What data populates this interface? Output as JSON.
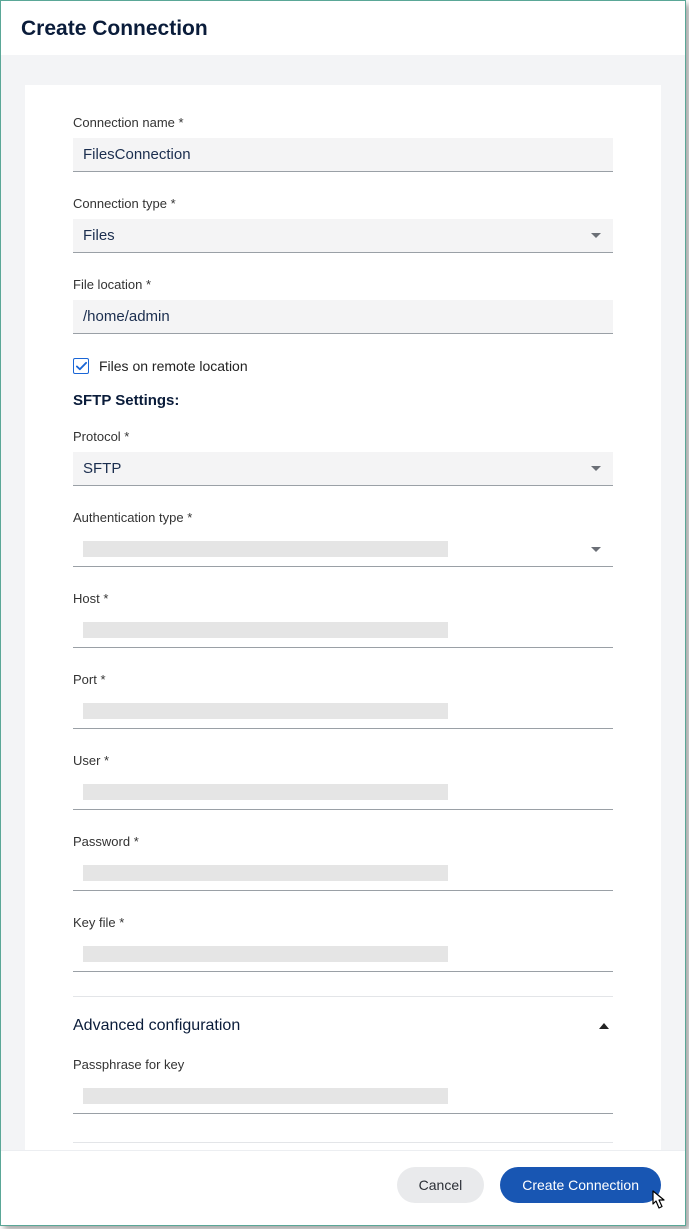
{
  "dialog": {
    "title": "Create Connection"
  },
  "form": {
    "connectionName": {
      "label": "Connection name *",
      "value": "FilesConnection"
    },
    "connectionType": {
      "label": "Connection type *",
      "value": "Files"
    },
    "fileLocation": {
      "label": "File location *",
      "value": "/home/admin"
    },
    "remoteCheckbox": {
      "label": "Files on remote location",
      "checked": true
    },
    "sftpHeading": "SFTP Settings:",
    "protocol": {
      "label": "Protocol *",
      "value": "SFTP"
    },
    "authType": {
      "label": "Authentication type *",
      "value": ""
    },
    "host": {
      "label": "Host *",
      "value": ""
    },
    "port": {
      "label": "Port *",
      "value": ""
    },
    "user": {
      "label": "User *",
      "value": ""
    },
    "password": {
      "label": "Password *",
      "value": ""
    },
    "keyFile": {
      "label": "Key file *",
      "value": ""
    },
    "advanced": {
      "title": "Advanced configuration"
    },
    "passphrase": {
      "label": "Passphrase for key",
      "value": ""
    }
  },
  "footer": {
    "cancel": "Cancel",
    "create": "Create Connection"
  }
}
